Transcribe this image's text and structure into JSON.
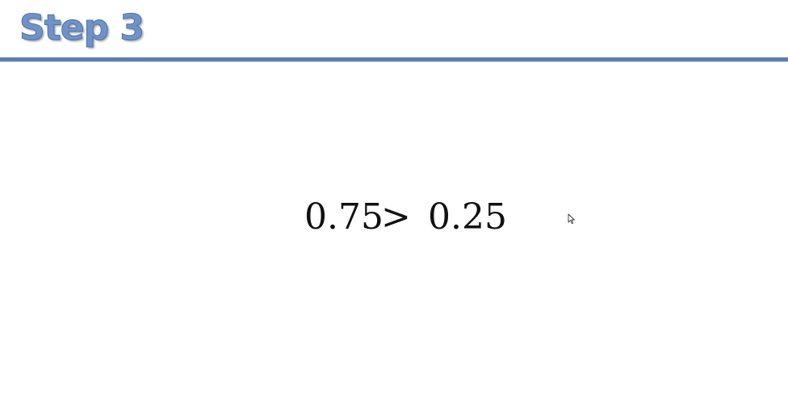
{
  "slide": {
    "title": "Step 3"
  },
  "equation": {
    "left": "0.75",
    "operator": ">",
    "right": "0.25"
  },
  "colors": {
    "title": "#6f93c9",
    "rule": "#5b7fb4",
    "text": "#111111"
  },
  "icons": {
    "cursor": "mouse-pointer-icon"
  }
}
